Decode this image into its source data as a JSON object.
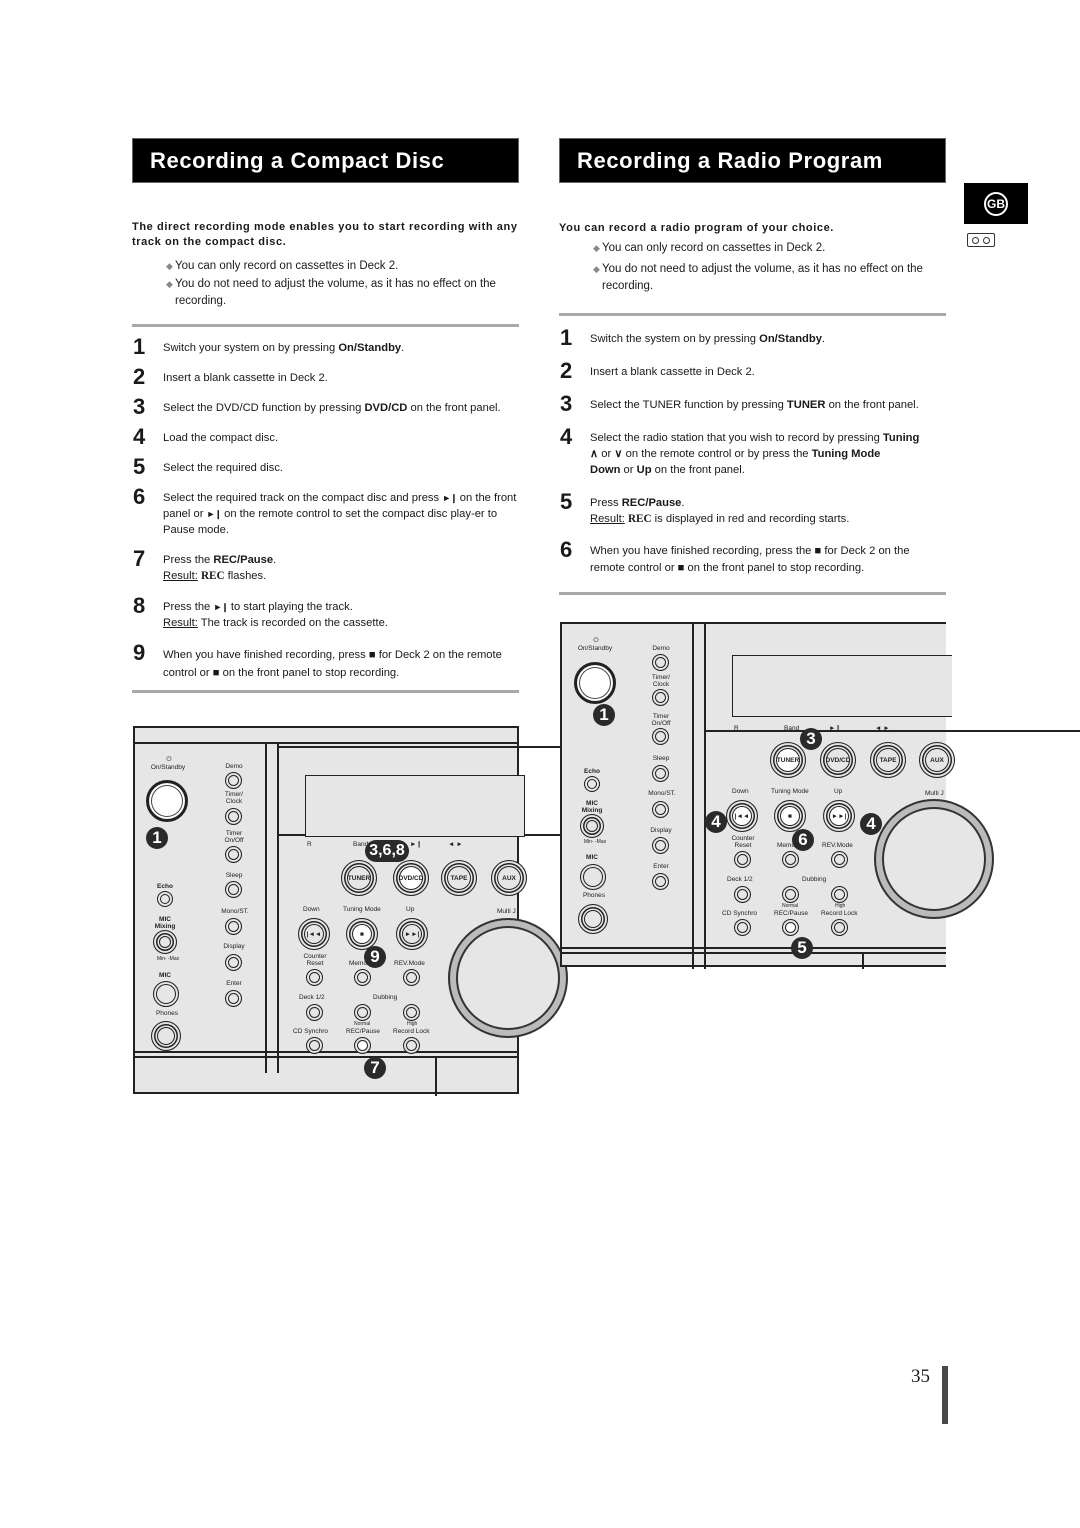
{
  "left": {
    "title": "Recording a Compact Disc",
    "intro": "The direct recording mode enables you to start recording with any track on the compact disc.",
    "bullets": [
      "You can only record on cassettes in Deck 2.",
      "You do not need to adjust the volume, as it has no effect on the recording."
    ],
    "steps": [
      {
        "num": "1",
        "pre": "Switch your system on by pressing ",
        "bold": "On/Standby",
        "post": "."
      },
      {
        "num": "2",
        "pre": "Insert a blank cassette in Deck 2.",
        "bold": "",
        "post": ""
      },
      {
        "num": "3",
        "pre": "Select the DVD/CD function by pressing ",
        "bold": "DVD/CD",
        "post": " on the front panel."
      },
      {
        "num": "4",
        "pre": "Load the compact disc.",
        "bold": "",
        "post": ""
      },
      {
        "num": "5",
        "pre": "Select the required disc.",
        "bold": "",
        "post": ""
      },
      {
        "num": "6",
        "a": "Select the required track on the compact disc and press ",
        "glyph": "►❙",
        "b": " on the front panel or ",
        "c": " on the remote control to set the compact disc play-er to Pause mode."
      },
      {
        "num": "7",
        "pre": "Press the ",
        "bold": "REC/Pause",
        "post": ".",
        "result_label": "Result:",
        "result_rec": "REC",
        "result_text": " flashes."
      },
      {
        "num": "8",
        "a": "Press the ",
        "glyph": "►❙",
        "b": " to start playing the track.",
        "result_label": "Result:",
        "result_text": " The track is recorded on the cassette."
      },
      {
        "num": "9",
        "a": "When you have finished recording, press ",
        "stop": "■",
        "b": " for Deck 2 on the remote control or ",
        "c": " on the front panel to stop recording."
      }
    ],
    "callouts": [
      "1",
      "3,6,8",
      "9",
      "7"
    ]
  },
  "right": {
    "title": "Recording a Radio Program",
    "intro": "You can record a radio program of your choice.",
    "bullets": [
      "You can only record on cassettes in Deck 2.",
      "You do not need to adjust the volume, as it has no effect on the recording."
    ],
    "steps": [
      {
        "num": "1",
        "pre": "Switch the system on by pressing ",
        "bold": "On/Standby",
        "post": "."
      },
      {
        "num": "2",
        "pre": "Insert a blank cassette in Deck 2.",
        "bold": "",
        "post": ""
      },
      {
        "num": "3",
        "pre": "Select the TUNER function by pressing ",
        "bold": "TUNER",
        "post": " on the front panel."
      },
      {
        "num": "4",
        "a": "Select the radio station that you wish to record by pressing ",
        "bold1": "Tuning",
        "up": "∧",
        "or": " or ",
        "down": "∨",
        "b": " on the remote control or by press the ",
        "bold2": "Tuning Mode",
        "bold3": "Down",
        "c": " or ",
        "bold4": "Up",
        "d": " on the front panel."
      },
      {
        "num": "5",
        "pre": "Press ",
        "bold": "REC/Pause",
        "post": ".",
        "result_label": "Result:",
        "result_rec": "REC",
        "result_text": " is displayed in red and recording starts."
      },
      {
        "num": "6",
        "a": "When you have finished recording, press the ",
        "stop": "■",
        "b": " for Deck 2 on the remote control  or ",
        "c": " on the front panel to stop recording."
      }
    ],
    "callouts": [
      "1",
      "3",
      "4",
      "4",
      "6",
      "5"
    ]
  },
  "panel": {
    "on_standby": "On/Standby",
    "demo": "Demo",
    "timer_clock": "Timer/ Clock",
    "timer_onoff": "Timer On/Off",
    "sleep": "Sleep",
    "mono_st": "Mono/ST.",
    "display": "Display",
    "enter": "Enter",
    "echo": "Echo",
    "mic_mixing": "MIC Mixing",
    "min_max": "Min-    -Max",
    "mic": "MIC",
    "phones": "Phones",
    "r_mark": "R",
    "band": "Band",
    "play_pause": "►❙",
    "skip": "◄ ►",
    "tuner": "TUNER",
    "dvd_cd": "DVD/CD",
    "tape": "TAPE",
    "aux": "AUX",
    "down": "Down",
    "tuning_mode": "Tuning Mode",
    "up": "Up",
    "multi": "Multi J",
    "prev": "|◄◄",
    "stop": "■",
    "next": "►►|",
    "counter_reset": "Counter Reset",
    "memory": "Memory",
    "rev_mode": "REV.Mode",
    "deck12": "Deck 1/2",
    "dubbing": "Dubbing",
    "normal": "Normal",
    "high": "High",
    "cd_synchro": "CD Synchro",
    "rec_pause": "REC/Pause",
    "record_lock": "Record Lock"
  },
  "side": {
    "language_badge": "GB",
    "cassette_icon": "cassette-icon"
  },
  "page_number": "35"
}
